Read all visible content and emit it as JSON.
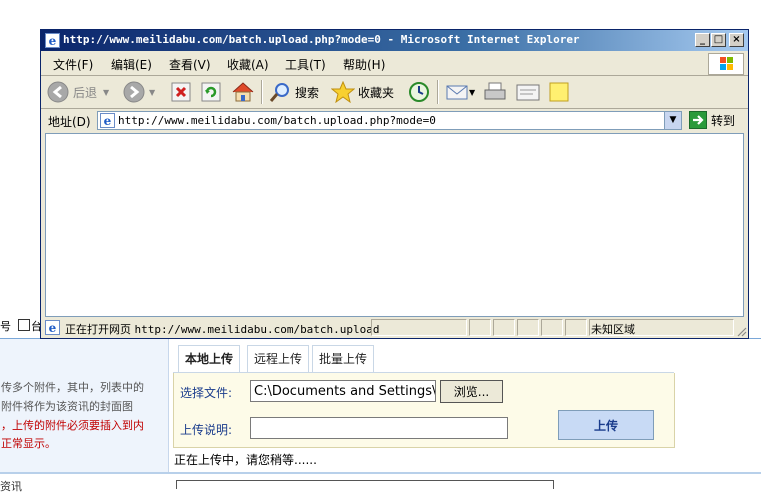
{
  "background_page": {
    "row_fragment_1": "号",
    "row_fragment_2": "台",
    "tabs": [
      "本地上传",
      "远程上传",
      "批量上传"
    ],
    "hints": [
      "传多个附件，其中，列表中的",
      "附件将作为该资讯的封面图",
      "，上传的附件必须要插入到内",
      "正常显示。"
    ],
    "file_label": "选择文件:",
    "file_value": "C:\\Documents and Settings\\A",
    "browse_label": "浏览...",
    "desc_label": "上传说明:",
    "desc_value": "",
    "upload_label": "上传",
    "uploading_text": "正在上传中，请您稍等......",
    "bottom_text": "资讯"
  },
  "ie": {
    "title": "http://www.meilidabu.com/batch.upload.php?mode=0 - Microsoft Internet Explorer",
    "window_buttons": {
      "minimize": "_",
      "maximize": "□",
      "close": "×"
    },
    "menu": [
      "文件(F)",
      "编辑(E)",
      "查看(V)",
      "收藏(A)",
      "工具(T)",
      "帮助(H)"
    ],
    "toolbar": {
      "back_label": "后退",
      "search_label": "搜索",
      "favorites_label": "收藏夹"
    },
    "address": {
      "label": "地址(D)",
      "url": "http://www.meilidabu.com/batch.upload.php?mode=0",
      "go_label": "转到"
    },
    "status": {
      "text": "正在打开网页",
      "url": "http://www.meilidabu.com/batch.upload",
      "zone": "未知区域"
    }
  }
}
